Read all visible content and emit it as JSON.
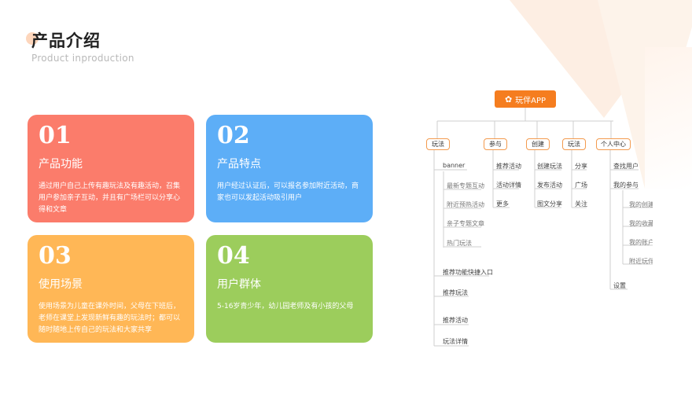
{
  "header": {
    "title": "产品介绍",
    "subtitle": "Product inproduction"
  },
  "cards": [
    {
      "num": "01",
      "title": "产品功能",
      "desc": "通过用户自己上传有趣玩法及有趣活动，召集用户参加亲子互动，并且有广场栏可以分享心得和文章",
      "color": "#fb7c6b"
    },
    {
      "num": "02",
      "title": "产品特点",
      "desc": "用户经过认证后，可以报名参加附近活动，商家也可以发起活动吸引用户",
      "color": "#5daef7"
    },
    {
      "num": "03",
      "title": "使用场景",
      "desc": "使用场景为儿童在课外时间，父母在下班后，老师在课堂上发现新鲜有趣的玩法时；都可以随时随地上传自己的玩法和大家共享",
      "color": "#ffb756"
    },
    {
      "num": "04",
      "title": "用户群体",
      "desc": "5-16岁青少年，幼儿园老师及有小孩的父母",
      "color": "#9ccd5c"
    }
  ],
  "mindmap": {
    "root": "玩伴APP",
    "root_icon": "flower-icon",
    "accent": "#f57d1f",
    "branches": [
      {
        "label": "玩法",
        "items": [
          "banner",
          "最新专题互动",
          "附近预热活动",
          "亲子专题文章",
          "热门玩法",
          "推荐功能快捷入口",
          "推荐玩法",
          "推荐活动",
          "玩法详情"
        ]
      },
      {
        "label": "参与",
        "items": [
          "推荐活动",
          "活动详情",
          "更多"
        ]
      },
      {
        "label": "创建",
        "items": [
          "创建玩法",
          "发布活动",
          "图文分享"
        ]
      },
      {
        "label": "玩法",
        "items": [
          "分享",
          "广场",
          "关注"
        ]
      },
      {
        "label": "个人中心",
        "items": [
          "查找用户",
          "我的参与",
          "我的创建",
          "我的收藏",
          "我的账户",
          "附近玩伴",
          "设置"
        ]
      }
    ]
  }
}
